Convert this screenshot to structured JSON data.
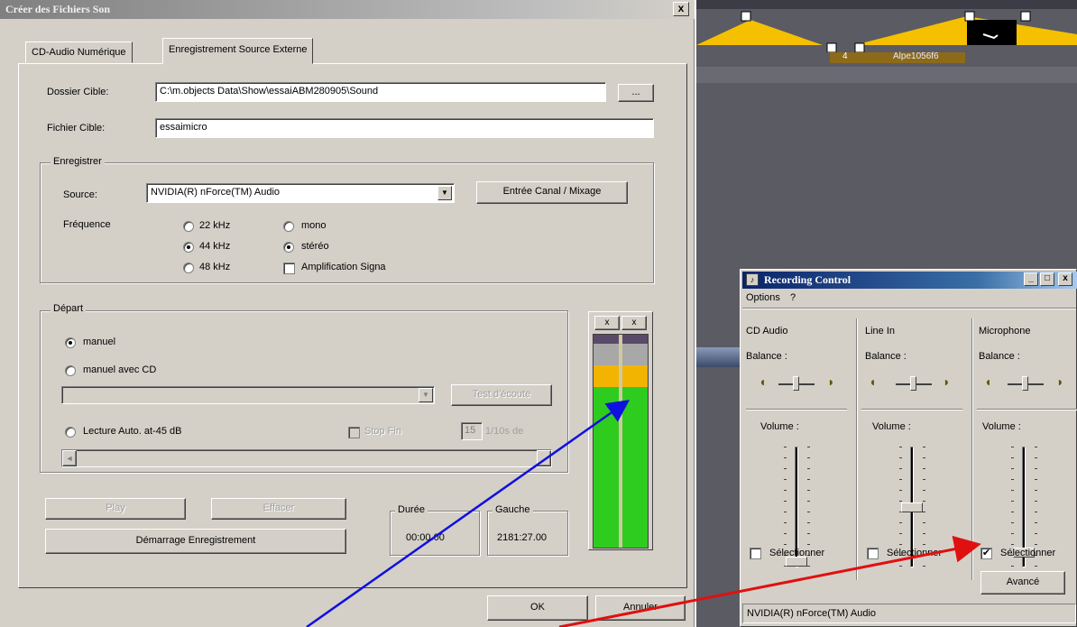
{
  "dialog": {
    "title": "Créer des Fichiers Son",
    "close_label": "x",
    "tabs": [
      {
        "label": "CD-Audio Numérique"
      },
      {
        "label": "Enregistrement Source Externe"
      }
    ],
    "target_folder": {
      "label": "Dossier Cible:",
      "value": "C:\\m.objects Data\\Show\\essaiABM280905\\Sound",
      "browse_label": "..."
    },
    "target_file": {
      "label": "Fichier Cible:",
      "value": "essaimicro"
    },
    "record_group": {
      "title": "Enregistrer",
      "source_label": "Source:",
      "source_value": "NVIDIA(R) nForce(TM) Audio",
      "channel_button": "Entrée Canal / Mixage",
      "freq_label": "Fréquence",
      "freq_options": [
        "22 kHz",
        "44 kHz",
        "48 kHz"
      ],
      "freq_selected": "44 kHz",
      "channel_options": [
        "mono",
        "stéréo"
      ],
      "channel_selected": "stéréo",
      "amp_label": "Amplification Signa"
    },
    "start_group": {
      "title": "Départ",
      "manual_label": "manuel",
      "manual_cd_label": "manuel avec CD",
      "listen_test_label": "Test d'écoute",
      "auto_label": "Lecture Auto. at-45 dB",
      "stopfin_label": "Stop Fin",
      "seconds_value": "15",
      "seconds_unit": "1/10s de"
    },
    "vu_labels": [
      "x",
      "x"
    ],
    "play_label": "Play",
    "erase_label": "Effacer",
    "record_button": "Démarrage Enregistrement",
    "duration": {
      "title": "Durée",
      "value": "00:00.00"
    },
    "left": {
      "title": "Gauche",
      "value": "2181:27.00"
    },
    "ok_label": "OK",
    "cancel_label": "Annuler"
  },
  "timeline": {
    "clip_label": "Alpe1056f6",
    "clip_number": "4"
  },
  "recording_control": {
    "title": "Recording Control",
    "menu": [
      "Options",
      "?"
    ],
    "window_buttons": [
      "_",
      "□",
      "x"
    ],
    "columns": [
      {
        "name": "CD Audio",
        "balance_label": "Balance :",
        "volume_label": "Volume :",
        "select_label": "Sélectionner",
        "selected": false,
        "volume_level": 0.1
      },
      {
        "name": "Line In",
        "balance_label": "Balance :",
        "volume_label": "Volume :",
        "select_label": "Sélectionner",
        "selected": false,
        "volume_level": 0.5
      },
      {
        "name": "Microphone",
        "balance_label": "Balance :",
        "volume_label": "Volume :",
        "select_label": "Sélectionner",
        "selected": true,
        "volume_level": 0.2
      }
    ],
    "advanced_label": "Avancé",
    "status": "NVIDIA(R) nForce(TM) Audio"
  },
  "colors": {
    "dialog_face": "#d4d0c8",
    "title_active": "#0a246a",
    "meter_green": "#2ecc1e",
    "meter_yellow": "#f2b400",
    "arrow_blue": "#1010e0",
    "arrow_red": "#e01010",
    "timeline_yellow": "#f5c000"
  }
}
